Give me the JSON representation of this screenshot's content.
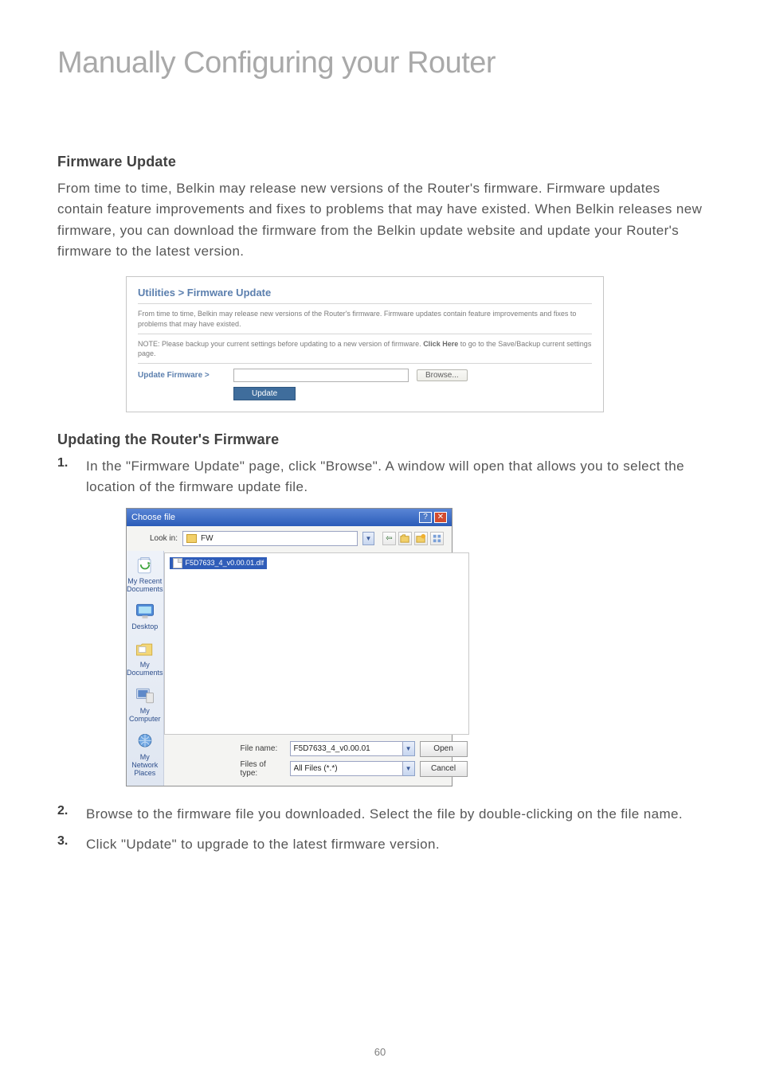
{
  "page": {
    "title": "Manually Configuring your Router",
    "section1_heading": "Firmware Update",
    "section1_body": "From time to time, Belkin may release new versions of the Router's firmware. Firmware updates contain feature improvements and fixes to problems that may have existed. When Belkin releases new firmware, you can download the firmware from the Belkin update website and update your Router's firmware to the latest version.",
    "section2_heading": "Updating the Router's Firmware",
    "page_number": "60"
  },
  "steps": [
    {
      "num": "1.",
      "text": "In the \"Firmware Update\" page, click \"Browse\". A window will open that allows you to select the location of the firmware update file."
    },
    {
      "num": "2.",
      "text": "Browse to the firmware file you downloaded. Select the file by double-clicking on the file name."
    },
    {
      "num": "3.",
      "text": "Click \"Update\" to upgrade to the latest firmware version."
    }
  ],
  "screenshot1": {
    "title": "Utilities > Firmware Update",
    "desc": "From time to time, Belkin may release new versions of the Router's firmware. Firmware updates contain feature improvements and fixes to problems that may have existed.",
    "note_prefix": "NOTE: Please backup your current settings before updating to a new version of firmware. ",
    "note_link": "Click Here",
    "note_suffix": " to go to the Save/Backup current settings page.",
    "row_label": "Update Firmware >",
    "browse_btn": "Browse...",
    "update_btn": "Update"
  },
  "screenshot2": {
    "titlebar": "Choose file",
    "lookin_label": "Look in:",
    "lookin_value": "FW",
    "file_item": "F5D7633_4_v0.00.01.dlf",
    "places": {
      "recent": "My Recent Documents",
      "desktop": "Desktop",
      "docs": "My Documents",
      "computer": "My Computer",
      "network": "My Network Places"
    },
    "filename_label": "File name:",
    "filename_value": "F5D7633_4_v0.00.01",
    "filetype_label": "Files of type:",
    "filetype_value": "All Files (*.*)",
    "open_btn": "Open",
    "cancel_btn": "Cancel"
  }
}
